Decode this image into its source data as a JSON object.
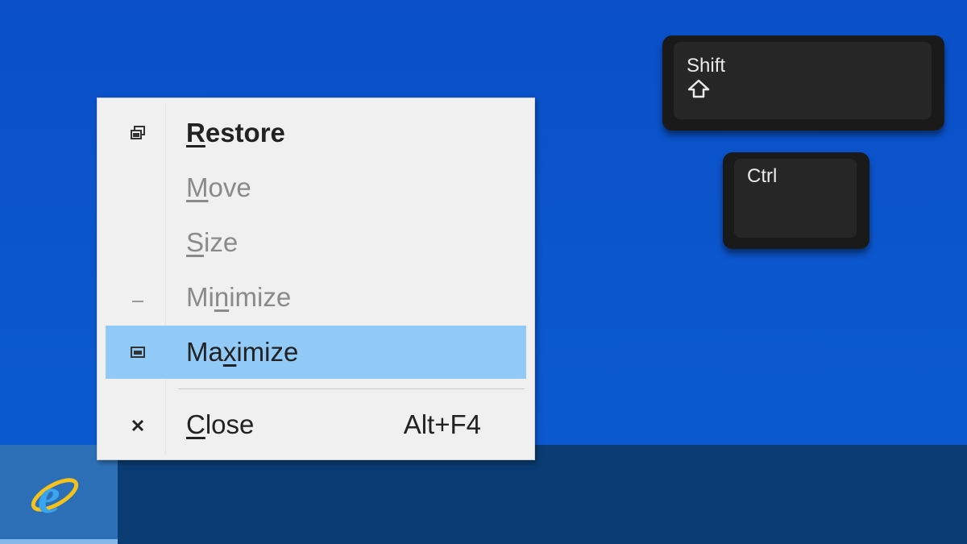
{
  "menu": {
    "items": [
      {
        "name": "restore",
        "pre": "",
        "ul": "R",
        "post": "estore",
        "shortcut": "",
        "icon": "restore-icon",
        "enabled": true,
        "bold": true,
        "highlighted": false
      },
      {
        "name": "move",
        "pre": "",
        "ul": "M",
        "post": "ove",
        "shortcut": "",
        "icon": "",
        "enabled": false,
        "bold": false,
        "highlighted": false
      },
      {
        "name": "size",
        "pre": "",
        "ul": "S",
        "post": "ize",
        "shortcut": "",
        "icon": "",
        "enabled": false,
        "bold": false,
        "highlighted": false
      },
      {
        "name": "minimize",
        "pre": "Mi",
        "ul": "n",
        "post": "imize",
        "shortcut": "",
        "icon": "minimize-icon",
        "enabled": false,
        "bold": false,
        "highlighted": false
      },
      {
        "name": "maximize",
        "pre": "Ma",
        "ul": "x",
        "post": "imize",
        "shortcut": "",
        "icon": "maximize-icon",
        "enabled": true,
        "bold": false,
        "highlighted": true
      },
      {
        "name": "close",
        "pre": "",
        "ul": "C",
        "post": "lose",
        "shortcut": "Alt+F4",
        "icon": "close-icon",
        "enabled": true,
        "bold": false,
        "highlighted": false
      }
    ]
  },
  "keys": {
    "shift_label": "Shift",
    "ctrl_label": "Ctrl"
  },
  "taskbar": {
    "app_icon": "internet-explorer-icon"
  },
  "colors": {
    "desktop": "#0b55cc",
    "taskbar": "#0a3b72",
    "menu_bg": "#f0f0f0",
    "highlight": "#91c9f7"
  }
}
